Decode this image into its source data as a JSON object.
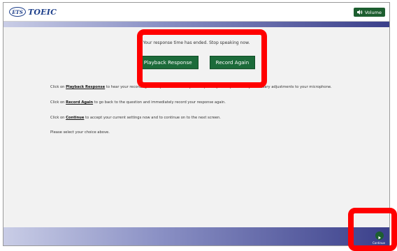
{
  "header": {
    "logo_ets": "ETS",
    "logo_product": "TOEIC",
    "volume_label": "Volume"
  },
  "main": {
    "message": "Your response time has ended. Stop speaking now.",
    "buttons": {
      "playback": "Playback Response",
      "record": "Record Again"
    },
    "instructions": [
      {
        "pre": "Click on ",
        "link": "Playback Response",
        "post": " to hear your recording. Once you have heard your response you may make any necessary adjustments to your microphone."
      },
      {
        "pre": "Click on ",
        "link": "Record Again",
        "post": " to go back to the question and immediately record your response again."
      },
      {
        "pre": "Click on ",
        "link": "Continue",
        "post": " to accept your current settings now and to continue on to the next screen."
      }
    ],
    "prompt": "Please select your choice above."
  },
  "footer": {
    "continue_label": "Continue"
  },
  "colors": {
    "header_button_green": "#1c5e2f",
    "action_button_green": "#1c6b3a",
    "band_light": "#c9cde6",
    "band_dark": "#3a3f8a",
    "highlight_red": "#ff0000",
    "logo_blue": "#1c3e8a"
  },
  "icons": {
    "volume": "speaker-icon",
    "continue": "play-arrow-icon"
  }
}
